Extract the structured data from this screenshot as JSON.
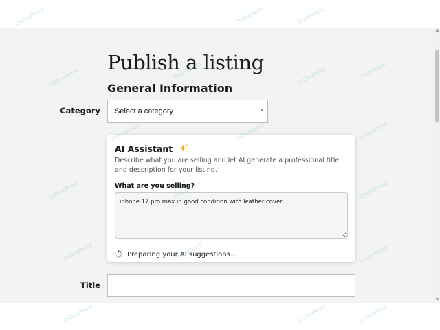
{
  "page": {
    "title": "Publish a listing",
    "section_title": "General Information"
  },
  "category": {
    "label": "Category",
    "selected": "Select a category"
  },
  "ai_assistant": {
    "title": "AI Assistant",
    "icon": "sparkle-icon",
    "description": "Describe what you are selling and let AI generate a professional title and description for your listing.",
    "question_label": "What are you selling?",
    "input_value": "iphone 17 pro max in good condition with leather cover",
    "status": "Preparing your AI suggestions...",
    "status_icon": "spinner-icon"
  },
  "title_field": {
    "label": "Title",
    "value": ""
  },
  "watermark": {
    "text": "OnlinePoint"
  },
  "colors": {
    "background": "#f3f3f2",
    "sparkle": "#f0b429",
    "watermark": "#6ec8c3"
  }
}
